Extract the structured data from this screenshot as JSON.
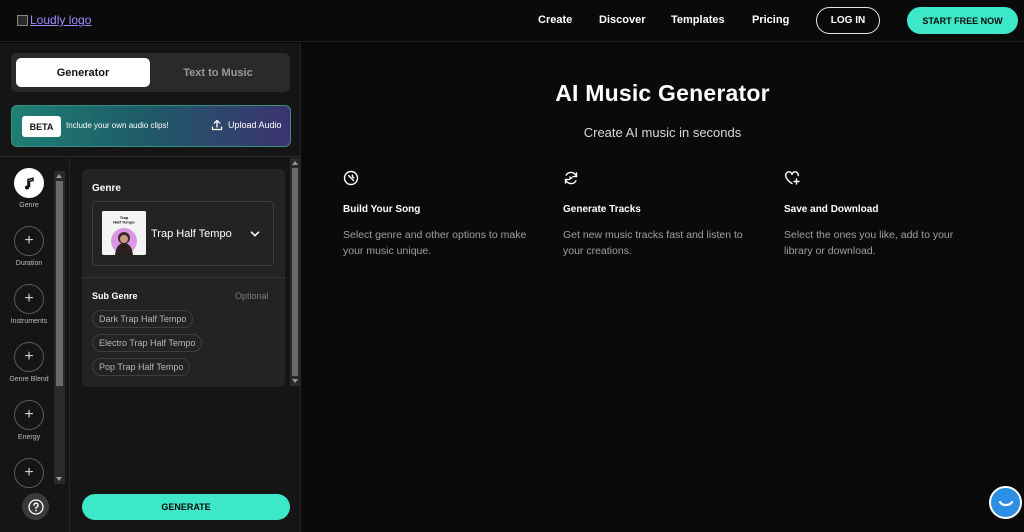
{
  "header": {
    "logo_alt": "Loudly logo",
    "nav": [
      "Create",
      "Discover",
      "Templates",
      "Pricing"
    ],
    "login": "LOG IN",
    "start": "START FREE NOW"
  },
  "tabs": {
    "generator": "Generator",
    "text_to_music": "Text to Music"
  },
  "beta": {
    "badge": "BETA",
    "text": "Include your own audio clips!",
    "upload": "Upload Audio"
  },
  "steps": [
    {
      "label": "Genre",
      "icon": "music-note-icon"
    },
    {
      "label": "Duration",
      "icon": "plus-icon"
    },
    {
      "label": "Instruments",
      "icon": "plus-icon"
    },
    {
      "label": "Genre Blend",
      "icon": "plus-icon"
    },
    {
      "label": "Energy",
      "icon": "plus-icon"
    },
    {
      "label": "",
      "icon": "plus-icon"
    }
  ],
  "genre_card": {
    "title": "Genre",
    "selected": "Trap Half Tempo",
    "thumb_text": "Trap\nHalf Tempo",
    "subgenre_title": "Sub Genre",
    "optional": "Optional",
    "chips": [
      "Dark Trap Half Tempo",
      "Electro Trap Half Tempo",
      "Pop Trap Half Tempo"
    ]
  },
  "generate": "GENERATE",
  "main": {
    "title": "AI Music Generator",
    "subtitle": "Create AI music in seconds",
    "features": [
      {
        "icon": "wrench-icon",
        "title": "Build Your Song",
        "desc": "Select genre and other options to make your music unique."
      },
      {
        "icon": "refresh-icon",
        "title": "Generate Tracks",
        "desc": "Get new music tracks fast and listen to your creations."
      },
      {
        "icon": "heart-plus-icon",
        "title": "Save and Download",
        "desc": "Select the ones you like, add to your library or download."
      }
    ]
  },
  "colors": {
    "accent": "#3de8c8",
    "background": "#0a0a0a",
    "panel": "#151515",
    "card": "#232323"
  }
}
